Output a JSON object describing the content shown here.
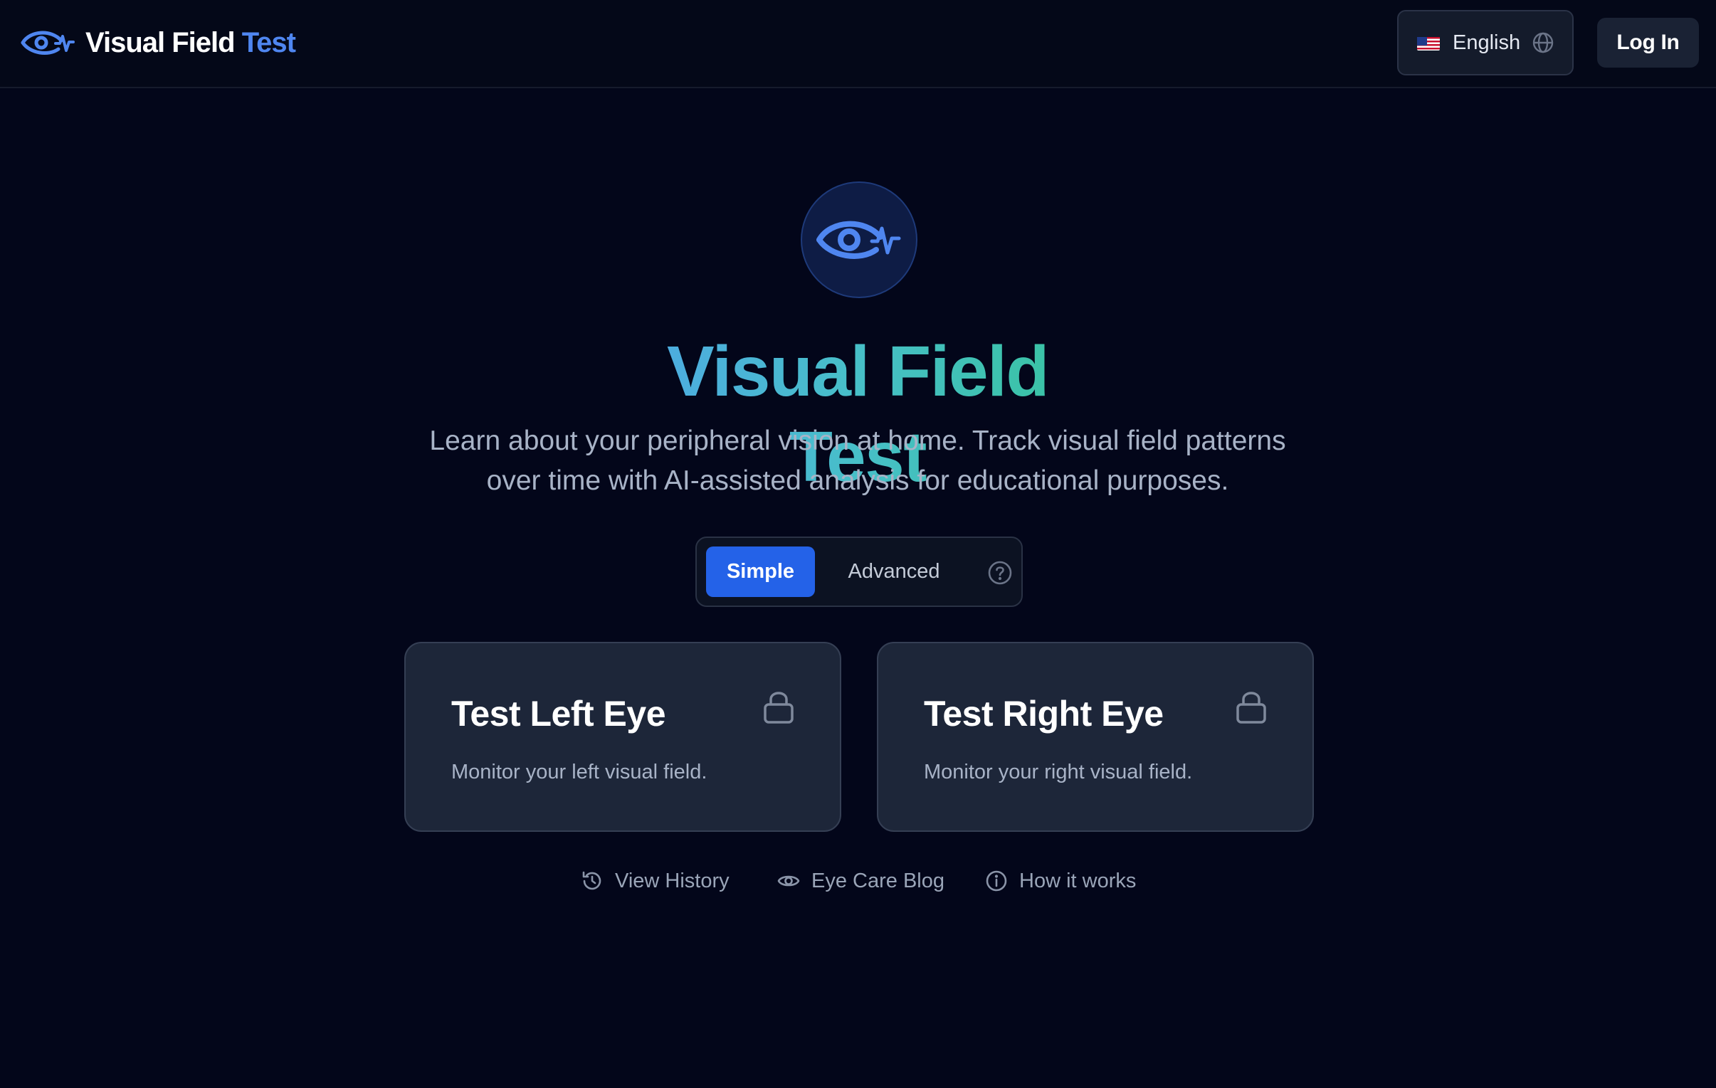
{
  "header": {
    "brand_part1": "Visual Field",
    "brand_part2": "Test",
    "language_label": "English",
    "login_label": "Log In"
  },
  "hero": {
    "title": "Visual Field Test",
    "subtitle_line1": "Learn about your peripheral vision at home. Track visual field patterns",
    "subtitle_line2": "over time with AI-assisted analysis for educational purposes."
  },
  "mode_toggle": {
    "options": [
      "Simple",
      "Advanced"
    ],
    "selected": "Simple"
  },
  "cards": [
    {
      "title": "Test Left Eye",
      "description": "Monitor your left visual field.",
      "icon": "lock-icon"
    },
    {
      "title": "Test Right Eye",
      "description": "Monitor your right visual field.",
      "icon": "lock-icon"
    }
  ],
  "links": [
    {
      "label": "View History",
      "icon": "history-icon"
    },
    {
      "label": "Eye Care Blog",
      "icon": "eye-icon"
    },
    {
      "label": "How it works",
      "icon": "info-icon"
    }
  ],
  "colors": {
    "background": "#03061a",
    "accent_blue": "#2462e8",
    "brand_blue": "#4f86f0",
    "card_bg": "#1d2639",
    "title_gradient_start": "#4fa6e8",
    "title_gradient_end": "#36c49a"
  }
}
